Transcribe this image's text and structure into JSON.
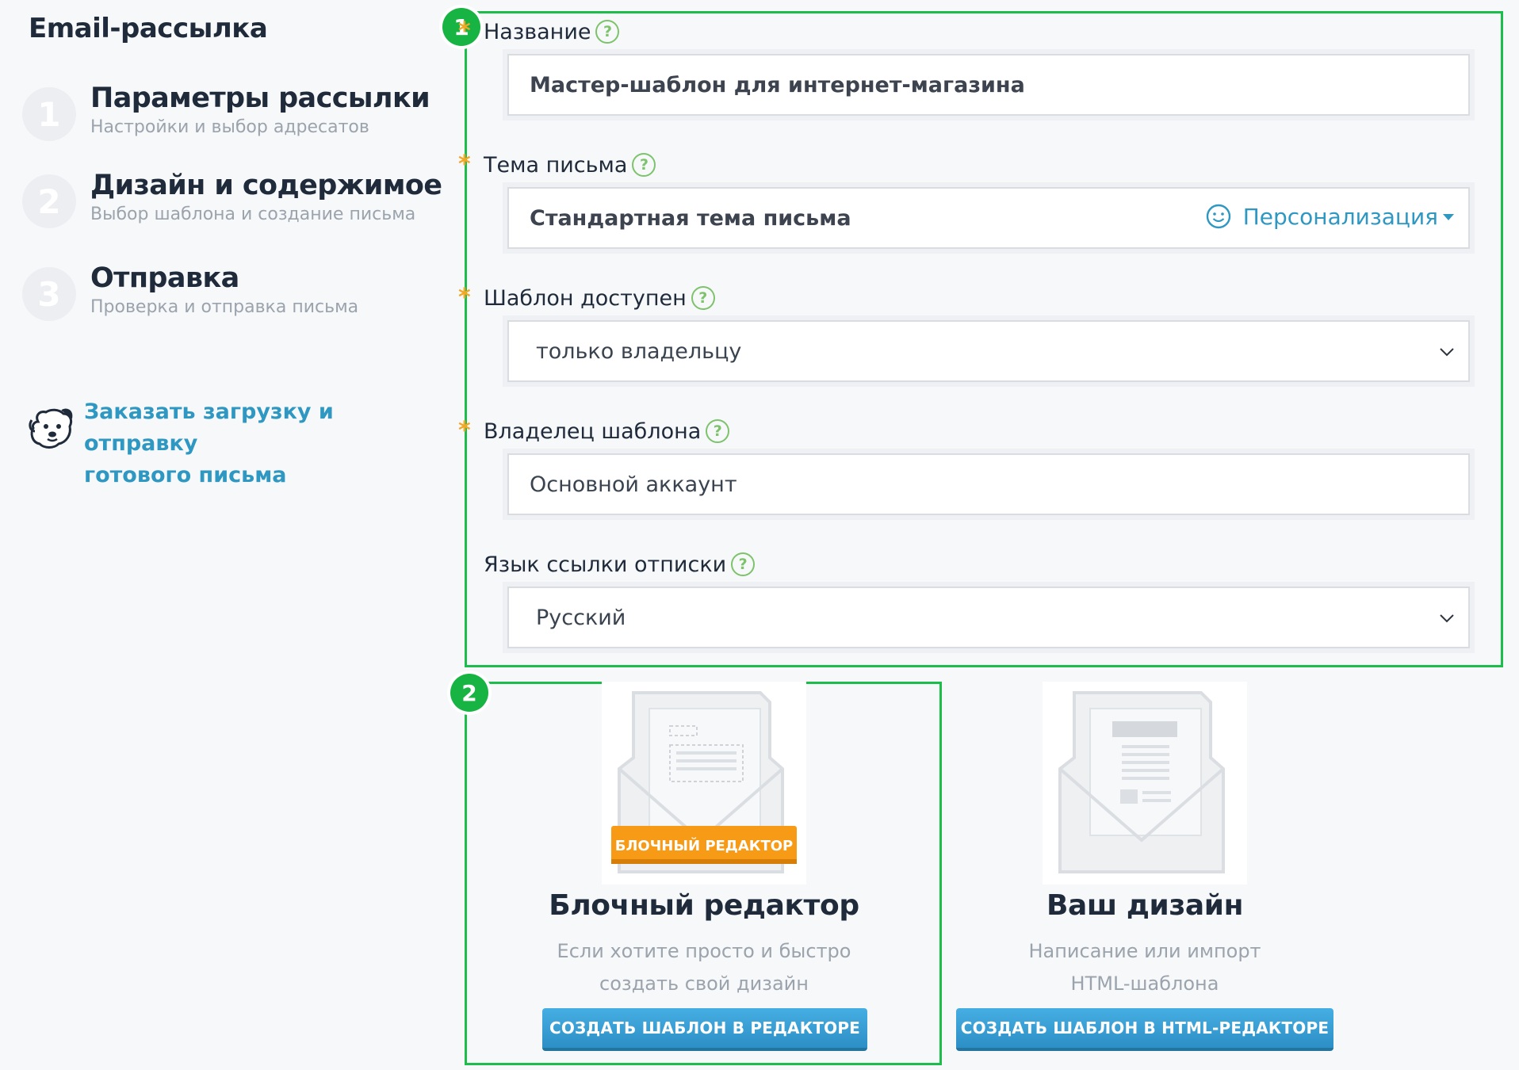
{
  "page_title": "Email-рассылка",
  "steps": [
    {
      "number": "1",
      "title": "Параметры рассылки",
      "subtitle": "Настройки и выбор адресатов"
    },
    {
      "number": "2",
      "title": "Дизайн и содержимое",
      "subtitle": "Выбор шаблона и создание письма"
    },
    {
      "number": "3",
      "title": "Отправка",
      "subtitle": "Проверка и отправка письма"
    }
  ],
  "order_link": {
    "line1": "Заказать загрузку и отправку",
    "line2": "готового письма"
  },
  "annotations": {
    "form_badge": "1",
    "editor_badge": "2"
  },
  "form": {
    "required_mark": "*",
    "help_mark": "?",
    "name": {
      "label": "Название",
      "value": "Мастер-шаблон для интернет-магазина"
    },
    "subject": {
      "label": "Тема письма",
      "value": "Стандартная тема письма",
      "personalize_label": "Персонализация"
    },
    "access": {
      "label": "Шаблон доступен",
      "selected": "только владельцу"
    },
    "owner": {
      "label": "Владелец шаблона",
      "value": "Основной аккаунт"
    },
    "unsubscribe_lang": {
      "label": "Язык ссылки отписки",
      "selected": "Русский"
    }
  },
  "editors": [
    {
      "badge": "БЛОЧНЫЙ РЕДАКТОР",
      "title": "Блочный редактор",
      "desc_line1": "Если хотите просто и быстро",
      "desc_line2": "создать свой дизайн",
      "button": "СОЗДАТЬ ШАБЛОН В РЕДАКТОРЕ"
    },
    {
      "title": "Ваш дизайн",
      "desc_line1": "Написание или импорт",
      "desc_line2": "HTML-шаблона",
      "button": "СОЗДАТЬ ШАБЛОН В HTML-РЕДАКТОРЕ"
    }
  ],
  "colors": {
    "accent_link": "#2e97c2",
    "annotation_green": "#1cbd4a",
    "required_orange": "#f5a623",
    "help_green": "#7dc36b",
    "button_blue": "#2c8fc5",
    "badge_orange": "#f79a16"
  }
}
